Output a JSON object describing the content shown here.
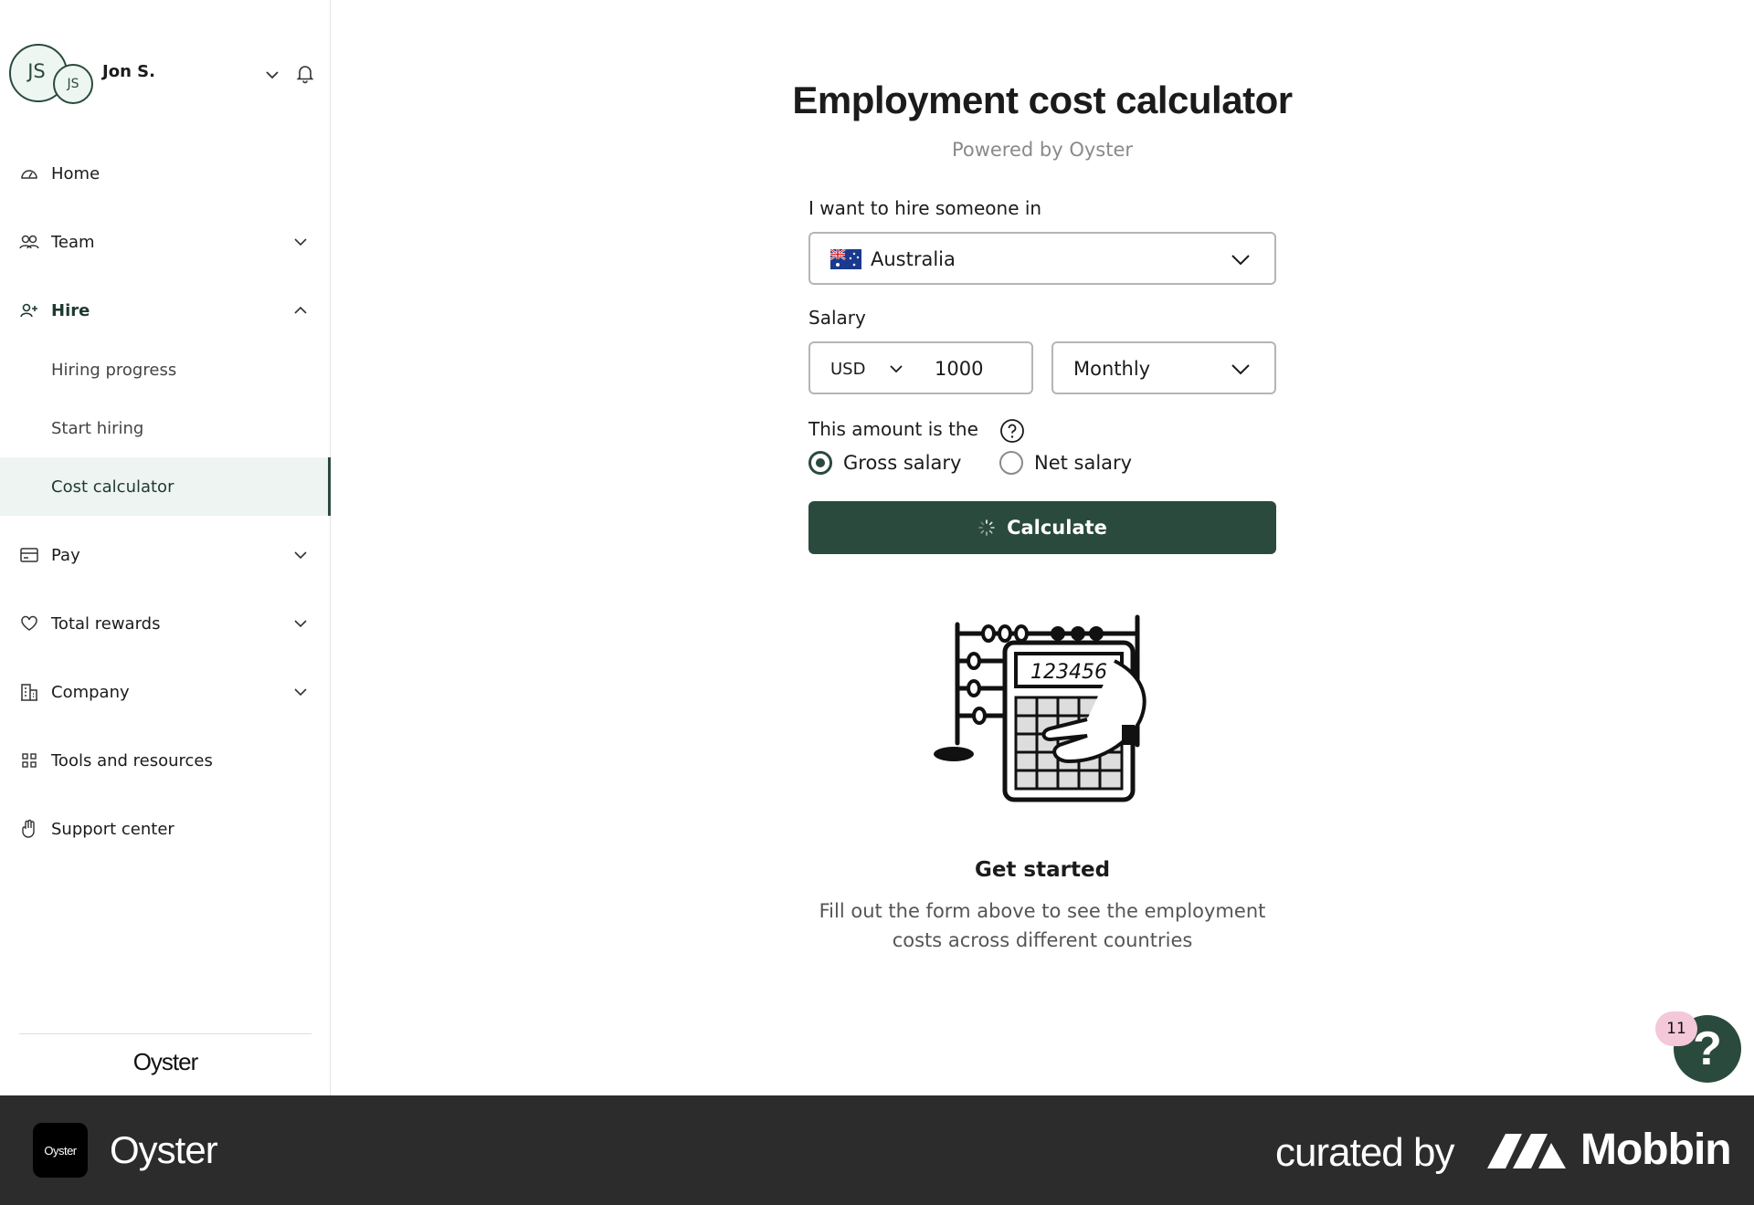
{
  "user": {
    "initials": "JS",
    "initials_small": "JS",
    "name": "Jon S."
  },
  "nav": {
    "home": "Home",
    "team": "Team",
    "hire": "Hire",
    "hire_sub": [
      "Hiring progress",
      "Start hiring",
      "Cost calculator"
    ],
    "pay": "Pay",
    "total_rewards": "Total rewards",
    "company": "Company",
    "tools": "Tools and resources",
    "support": "Support center"
  },
  "sidebar_logo": "Oyster",
  "page": {
    "title": "Employment cost calculator",
    "subtitle": "Powered by Oyster"
  },
  "form": {
    "country_label": "I want to hire someone in",
    "country_value": "Australia",
    "salary_label": "Salary",
    "currency": "USD",
    "amount": "1000",
    "period": "Monthly",
    "amount_type_label": "This amount is the",
    "options": [
      "Gross salary",
      "Net salary"
    ],
    "selected_option": "Gross salary",
    "calculate_label": "Calculate"
  },
  "empty_state": {
    "title": "Get started",
    "text": "Fill out the form above to see the employment costs across different countries"
  },
  "help_fab": {
    "badge": "11",
    "glyph": "?"
  },
  "footer": {
    "app_icon_text": "Oyster",
    "app_name": "Oyster",
    "curated_by": "curated by",
    "brand": "Mobbin"
  },
  "colors": {
    "accent": "#2a4a3d",
    "footer_bg": "#2c2c2c",
    "active_nav_bg": "#eef4f1"
  }
}
